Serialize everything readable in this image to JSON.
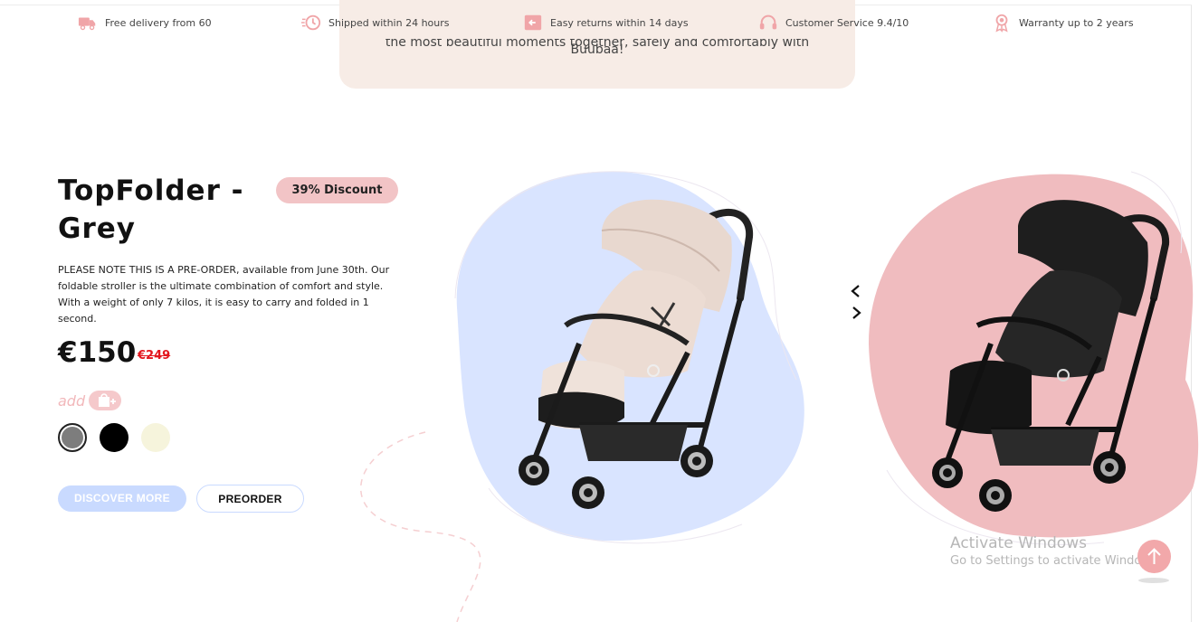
{
  "usp_bar": {
    "items": [
      {
        "label": "Free delivery from 60",
        "icon": "delivery-truck-icon"
      },
      {
        "label": "Shipped within 24 hours",
        "icon": "fast-clock-icon"
      },
      {
        "label": "Easy returns within 14 days",
        "icon": "return-box-icon"
      },
      {
        "label": "Customer Service 9.4/10",
        "icon": "headset-icon"
      },
      {
        "label": "Warranty up to 2 years",
        "icon": "award-ribbon-icon"
      }
    ],
    "icon_color": "#f0a5a8"
  },
  "quote": {
    "line1": "the most beautiful moments together, safely and comfortably with",
    "line2": "Buubaa!"
  },
  "product": {
    "title": "TopFolder - Grey",
    "discount_badge": "39% Discount",
    "description": "PLEASE NOTE THIS IS A PRE-ORDER, available from June 30th. Our foldable stroller is the ultimate combination of comfort and style. With a weight of only 7 kilos, it is easy to carry and folded in 1 second.",
    "price": "€150",
    "old_price": "€249",
    "add_label": "add",
    "colors": [
      {
        "name": "Grey",
        "hex": "#7d7d7d",
        "selected": true
      },
      {
        "name": "Black",
        "hex": "#000000",
        "selected": false
      },
      {
        "name": "Cream",
        "hex": "#f6f4dc",
        "selected": false
      }
    ],
    "discover_button": "DISCOVER MORE",
    "preorder_button": "PREORDER"
  },
  "carousel": {
    "main_blob_color": "#d9e4ff",
    "side_blob_color": "#f0bcbf",
    "prev_icon": "chevron-left-icon",
    "next_icon": "chevron-right-icon"
  },
  "windows_watermark": {
    "title": "Activate Windows",
    "subtitle": "Go to Settings to activate Windows."
  },
  "scroll_top_icon": "arrow-up-icon",
  "colors": {
    "accent_pink": "#f2c4c6",
    "accent_blue": "#c9daff",
    "sale_red": "#e3171e"
  }
}
